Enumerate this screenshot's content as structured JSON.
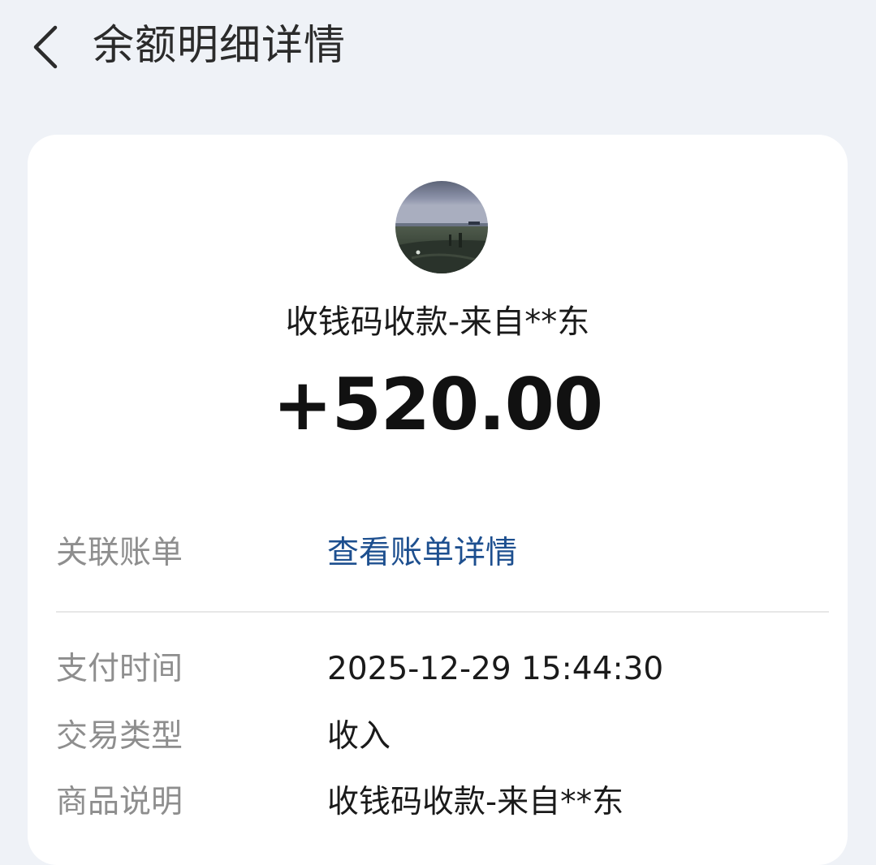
{
  "header": {
    "title": "余额明细详情",
    "back_icon": "chevron-left-icon"
  },
  "transaction": {
    "source_name": "收钱码收款-来自**东",
    "amount": "+520.00"
  },
  "details": [
    {
      "label": "关联账单",
      "value": "查看账单详情"
    },
    {
      "label": "支付时间",
      "value": "2025-12-29 15:44:30"
    },
    {
      "label": "交易类型",
      "value": "收入"
    },
    {
      "label": "商品说明",
      "value": "收钱码收款-来自**东"
    }
  ],
  "colors": {
    "background": "#eff2f7",
    "card": "#ffffff",
    "link": "#1d4f8f",
    "label": "#8e8e8e",
    "text": "#1a1a1a"
  }
}
